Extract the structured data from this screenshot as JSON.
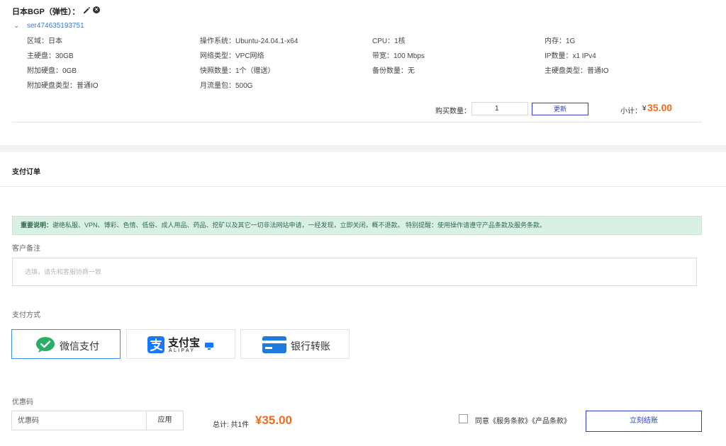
{
  "product": {
    "title": "日本BGP（弹性）：",
    "server_id": "ser474635193751",
    "specs": [
      "区域：日本",
      "操作系统：Ubuntu-24.04.1-x64",
      "CPU：1核",
      "内存：1G",
      "主硬盘：30GB",
      "网络类型：VPC网络",
      "带宽：100 Mbps",
      "IP数量：x1 IPv4",
      "附加硬盘：0GB",
      "快照数量：1个（赠送）",
      "备份数量：无",
      "主硬盘类型：普通IO",
      "附加硬盘类型：普通IO",
      "月流量包：500G"
    ],
    "qty_label": "购买数量：",
    "qty_value": "1",
    "update_label": "更新",
    "subtotal_label": "小计：",
    "subtotal_currency": "¥",
    "subtotal_value": "35.00"
  },
  "payment": {
    "title": "支付订单",
    "notice_bold": "重要说明：",
    "notice_text": "谢绝私服、VPN、博彩、色情、低俗、成人用品、药品、挖矿以及其它一切非法网站申请，一经发现，立即关闭，概不退款。 特别提醒：使用操作请遵守产品条款及服务条款。",
    "remark_label": "客户备注",
    "remark_placeholder": "选填，请先和客服协商一致",
    "method_label": "支付方式",
    "methods": {
      "wechat": "微信支付",
      "alipay_cn": "支付宝",
      "alipay_en": "ALIPAY",
      "bank": "银行转账"
    },
    "coupon_label": "优惠码",
    "coupon_placeholder": "优惠码",
    "apply_label": "应用",
    "total_label": "总计:  共1件",
    "total_value": "¥35.00",
    "agree_text": "同意《服务条款》《产品条款》",
    "checkout_label": "立刻结账"
  },
  "colors": {
    "accent": "#2f3fc8",
    "price": "#f26b1d",
    "link": "#3a7bd5",
    "notice_bg": "#d8f1e4",
    "wechat_green": "#2aae67",
    "alipay_blue": "#1677ff",
    "bank_blue": "#1f7ae0"
  },
  "icons": [
    "edit-icon",
    "close-circle-icon",
    "chevron-down-icon",
    "wechat-icon",
    "alipay-icon",
    "bank-card-icon"
  ]
}
